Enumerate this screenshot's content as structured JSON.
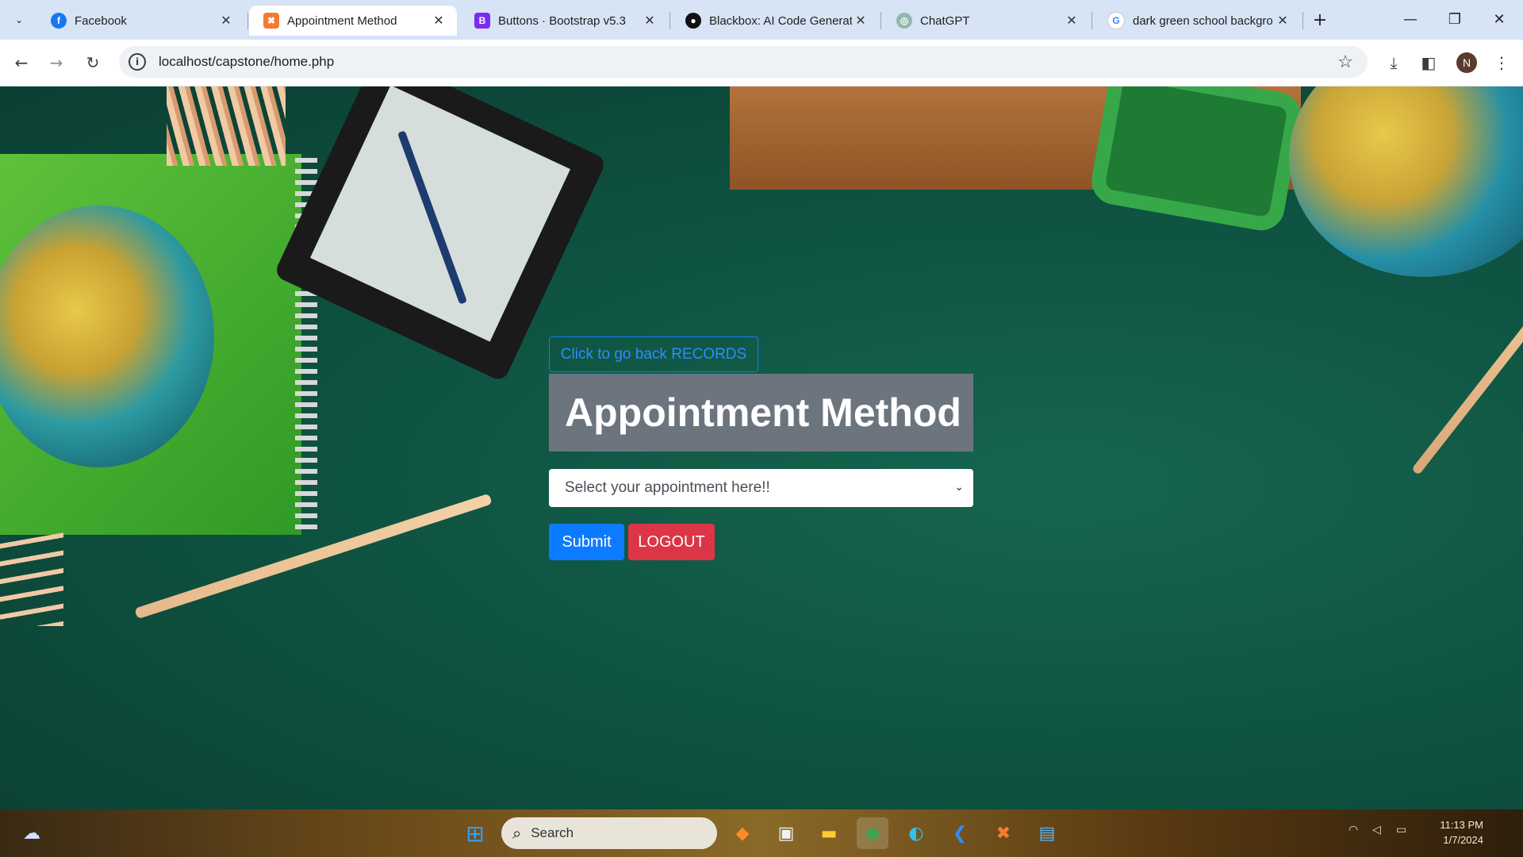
{
  "tabs": [
    {
      "title": "Facebook",
      "favicon": "facebook-icon",
      "active": false
    },
    {
      "title": "Appointment Method",
      "favicon": "xampp-icon",
      "active": true
    },
    {
      "title": "Buttons · Bootstrap v5.3",
      "favicon": "bootstrap-icon",
      "active": false
    },
    {
      "title": "Blackbox: AI Code Generat",
      "favicon": "blackbox-icon",
      "active": false
    },
    {
      "title": "ChatGPT",
      "favicon": "chatgpt-icon",
      "active": false
    },
    {
      "title": "dark green school backgro",
      "favicon": "google-icon",
      "active": false
    }
  ],
  "address_bar": {
    "url": "localhost/capstone/home.php"
  },
  "profile": {
    "initial": "N"
  },
  "form": {
    "back_button_label": "Click to go back RECORDS",
    "heading": "Appointment Method",
    "select_placeholder": "Select your appointment here!!",
    "submit_label": "Submit",
    "logout_label": "LOGOUT"
  },
  "taskbar": {
    "search_label": "Search",
    "time": "11:13 PM",
    "date": "1/7/2024"
  },
  "colors": {
    "primary": "#0d7bff",
    "danger": "#dc3545",
    "heading_bg": "#6c757d",
    "page_bg": "#0f5442"
  }
}
